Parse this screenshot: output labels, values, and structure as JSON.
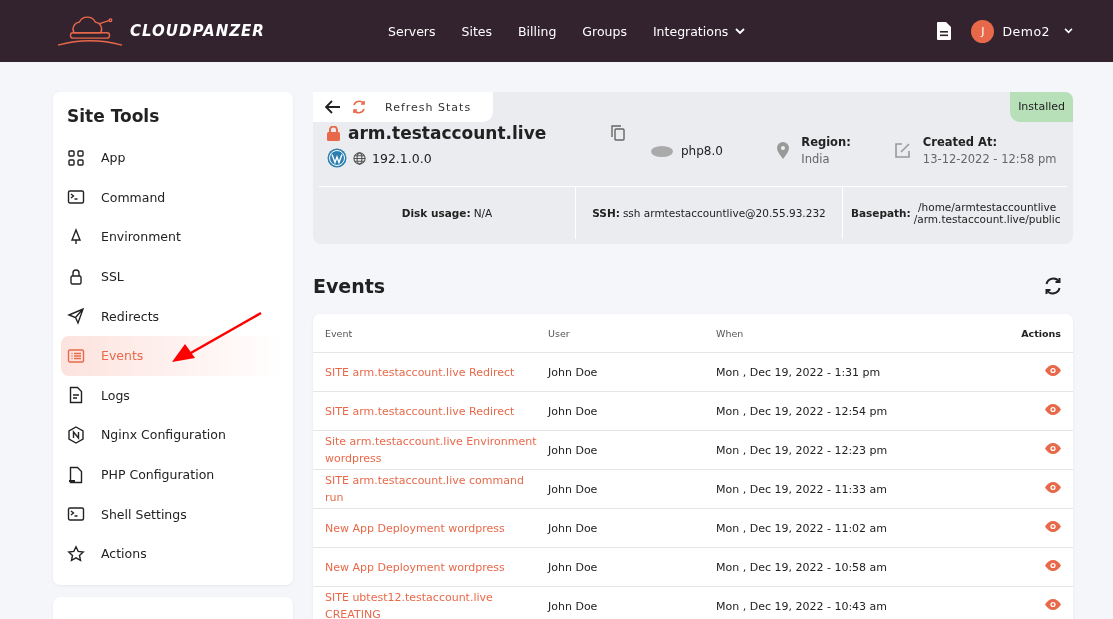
{
  "header": {
    "brand": "CLOUDPANZER",
    "nav": [
      {
        "label": "Servers",
        "has_menu": false
      },
      {
        "label": "Sites",
        "has_menu": false
      },
      {
        "label": "Billing",
        "has_menu": false
      },
      {
        "label": "Groups",
        "has_menu": false
      },
      {
        "label": "Integrations",
        "has_menu": true
      }
    ],
    "user": {
      "initial": "J",
      "name": "Demo2"
    }
  },
  "sidebar": {
    "title": "Site Tools",
    "items": [
      {
        "label": "App",
        "selected": false
      },
      {
        "label": "Command",
        "selected": false
      },
      {
        "label": "Environment",
        "selected": false
      },
      {
        "label": "SSL",
        "selected": false
      },
      {
        "label": "Redirects",
        "selected": false
      },
      {
        "label": "Events",
        "selected": true
      },
      {
        "label": "Logs",
        "selected": false
      },
      {
        "label": "Nginx Configuration",
        "selected": false
      },
      {
        "label": "PHP Configuration",
        "selected": false
      },
      {
        "label": "Shell Settings",
        "selected": false
      },
      {
        "label": "Actions",
        "selected": false
      }
    ]
  },
  "site": {
    "refresh_label": "Refresh Stats",
    "status": "Installed",
    "domain": "arm.testaccount.live",
    "ip": "192.1.0.0",
    "php": "php8.0",
    "region_label": "Region:",
    "region": "India",
    "created_label": "Created At:",
    "created": "13-12-2022 - 12:58 pm",
    "stats": [
      {
        "label": "Disk usage:",
        "value": "N/A"
      },
      {
        "label": "SSH:",
        "value": "ssh armtestaccountlive@20.55.93.232"
      },
      {
        "label": "Basepath:",
        "value": "/home/armtestaccountlive /arm.testaccount.live/public"
      }
    ]
  },
  "events": {
    "title": "Events",
    "columns": [
      "Event",
      "User",
      "When",
      "Actions"
    ],
    "rows": [
      {
        "event": "SITE arm.testaccount.live Redirect",
        "user": "John Doe",
        "when": "Mon , Dec 19, 2022 - 1:31 pm"
      },
      {
        "event": "SITE arm.testaccount.live Redirect",
        "user": "John Doe",
        "when": "Mon , Dec 19, 2022 - 12:54 pm"
      },
      {
        "event": "Site arm.testaccount.live Environment wordpress",
        "user": "John Doe",
        "when": "Mon , Dec 19, 2022 - 12:23 pm"
      },
      {
        "event": "SITE arm.testaccount.live command run",
        "user": "John Doe",
        "when": "Mon , Dec 19, 2022 - 11:33 am"
      },
      {
        "event": "New App Deployment wordpress",
        "user": "John Doe",
        "when": "Mon , Dec 19, 2022 - 11:02 am"
      },
      {
        "event": "New App Deployment wordpress",
        "user": "John Doe",
        "when": "Mon , Dec 19, 2022 - 10:58 am"
      },
      {
        "event": "SITE ubtest12.testaccount.live CREATING",
        "user": "John Doe",
        "when": "Mon , Dec 19, 2022 - 10:43 am"
      }
    ]
  }
}
